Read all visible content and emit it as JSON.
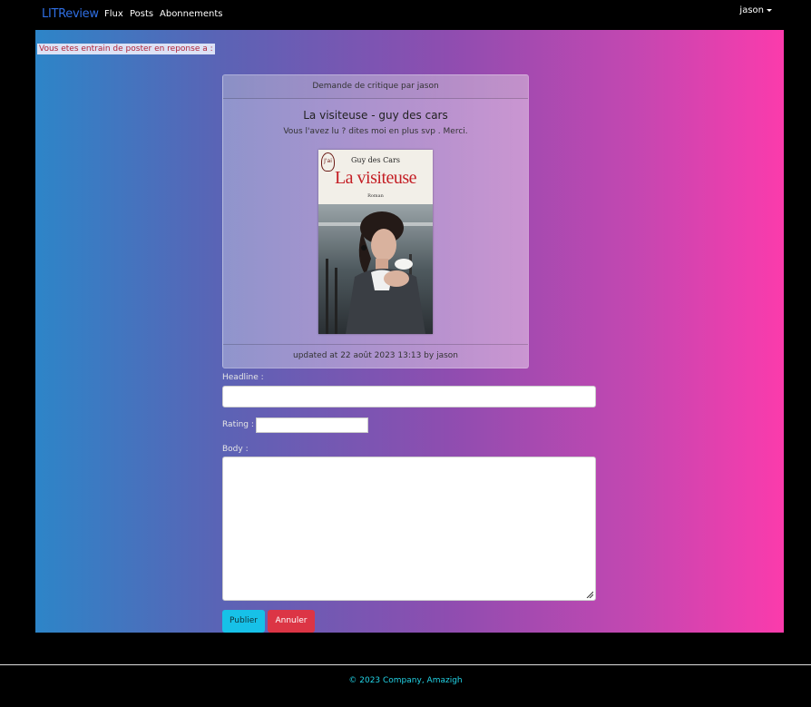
{
  "nav": {
    "brand": "LITReview",
    "links": [
      "Flux",
      "Posts",
      "Abonnements"
    ],
    "user": "jason"
  },
  "notice": "Vous etes entrain de poster en reponse a :",
  "ticket": {
    "header": "Demande de critique par jason",
    "title": "La visiteuse - guy des cars",
    "description": "Vous l'avez lu ? dites moi en plus svp . Merci.",
    "cover": {
      "author": "Guy des Cars",
      "title": "La visiteuse",
      "genre": "Roman",
      "logo": "J'ai lu"
    },
    "footer": "updated at 22 août 2023 13:13 by jason"
  },
  "form": {
    "headline_label": "Headline :",
    "headline_value": "",
    "rating_label": "Rating :",
    "rating_value": "",
    "body_label": "Body :",
    "body_value": "",
    "submit_label": "Publier",
    "cancel_label": "Annuler"
  },
  "colors": {
    "brand": "#2f6fe4",
    "submit": "#17c1e8",
    "cancel": "#dc3545",
    "footer_text": "#22d3e6"
  },
  "footer": "© 2023 Company, Amazigh"
}
